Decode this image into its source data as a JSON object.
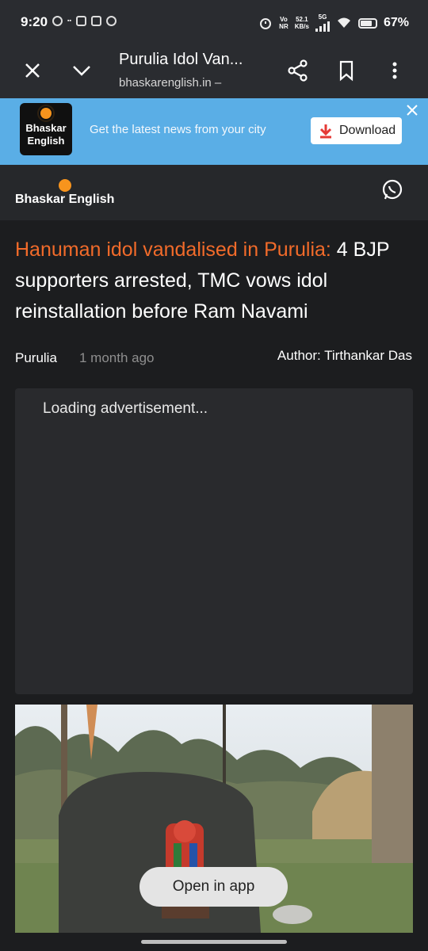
{
  "status_bar": {
    "time": "9:20",
    "network_label_top": "Vo",
    "network_label_bottom": "NR",
    "speed_value": "52.1",
    "speed_unit": "KB/s",
    "network_type": "5G",
    "battery": "67%"
  },
  "browser": {
    "page_title": "Purulia Idol Van...",
    "url": "bhaskarenglish.in – ",
    "icons": [
      "close-icon",
      "chevron-down-icon",
      "share-icon",
      "bookmark-icon",
      "more-vert-icon"
    ]
  },
  "app_banner": {
    "logo_line1": "Bhaskar",
    "logo_line2": "English",
    "message": "Get the latest news from your city",
    "download_label": "Download",
    "bg_color": "#5aaee6"
  },
  "site_header": {
    "logo_text": "Bhaskar English",
    "accent_color": "#f7941d"
  },
  "article": {
    "headline_accent": "Hanuman idol vandalised in Purulia:",
    "headline_rest": " 4 BJP supporters arrested, TMC vows idol reinstallation before Ram Navami",
    "headline_accent_color": "#f26b2a",
    "category": "Purulia",
    "time_ago": "1 month ago",
    "author": "Author: Tirthankar Das",
    "ad_placeholder": "Loading advertisement..."
  },
  "open_in_app_label": "Open in app"
}
